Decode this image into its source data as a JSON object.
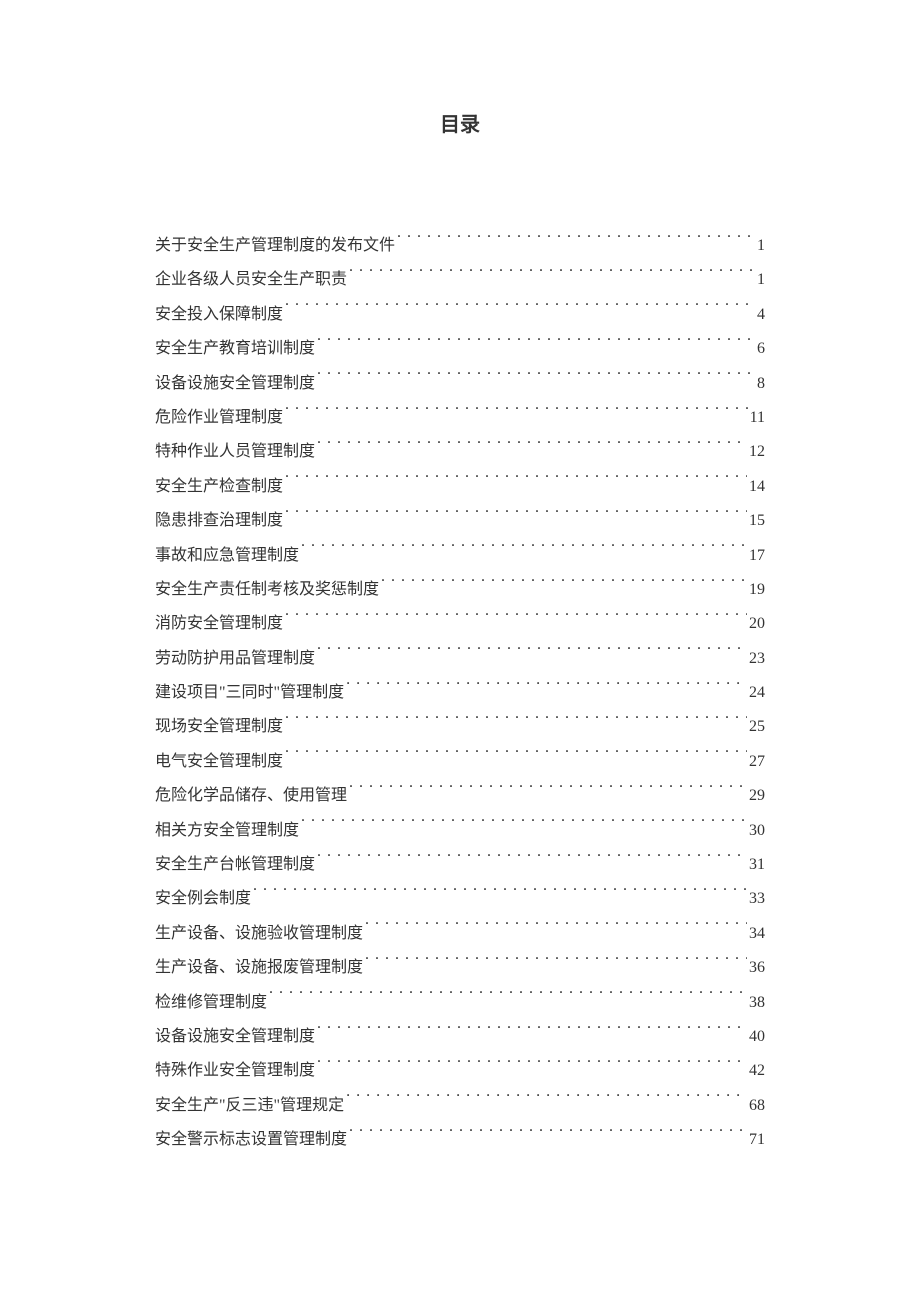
{
  "title": "目录",
  "entries": [
    {
      "label": "关于安全生产管理制度的发布文件",
      "page": "1"
    },
    {
      "label": "企业各级人员安全生产职责",
      "page": "1"
    },
    {
      "label": "安全投入保障制度",
      "page": "4"
    },
    {
      "label": "安全生产教育培训制度",
      "page": "6"
    },
    {
      "label": "设备设施安全管理制度",
      "page": "8"
    },
    {
      "label": "危险作业管理制度",
      "page": "11"
    },
    {
      "label": "特种作业人员管理制度",
      "page": "12"
    },
    {
      "label": "安全生产检查制度",
      "page": "14"
    },
    {
      "label": "隐患排查治理制度",
      "page": "15"
    },
    {
      "label": "事故和应急管理制度",
      "page": "17"
    },
    {
      "label": "安全生产责任制考核及奖惩制度",
      "page": "19"
    },
    {
      "label": "消防安全管理制度",
      "page": "20"
    },
    {
      "label": "劳动防护用品管理制度",
      "page": "23"
    },
    {
      "label": "建设项目\"三同时\"管理制度",
      "page": "24"
    },
    {
      "label": "现场安全管理制度",
      "page": "25"
    },
    {
      "label": "电气安全管理制度",
      "page": "27"
    },
    {
      "label": "危险化学品储存、使用管理",
      "page": "29"
    },
    {
      "label": "相关方安全管理制度",
      "page": "30"
    },
    {
      "label": "安全生产台帐管理制度",
      "page": "31"
    },
    {
      "label": "安全例会制度",
      "page": "33"
    },
    {
      "label": "生产设备、设施验收管理制度",
      "page": "34"
    },
    {
      "label": "生产设备、设施报废管理制度",
      "page": "36"
    },
    {
      "label": "检维修管理制度",
      "page": "38"
    },
    {
      "label": "设备设施安全管理制度",
      "page": "40"
    },
    {
      "label": "特殊作业安全管理制度",
      "page": "42"
    },
    {
      "label": "安全生产\"反三违\"管理规定",
      "page": "68"
    },
    {
      "label": "安全警示标志设置管理制度",
      "page": "71"
    }
  ]
}
